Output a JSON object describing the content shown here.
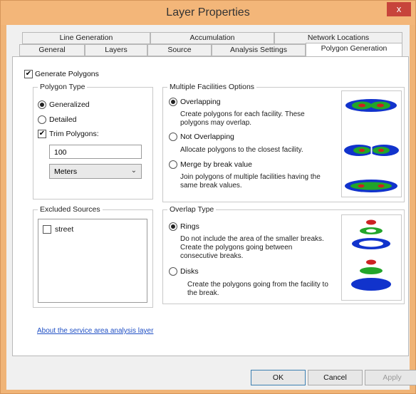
{
  "window": {
    "title": "Layer Properties",
    "close_glyph": "x"
  },
  "tabs_row1": [
    "Line Generation",
    "Accumulation",
    "Network Locations"
  ],
  "tabs_row2": [
    "General",
    "Layers",
    "Source",
    "Analysis Settings",
    "Polygon Generation"
  ],
  "generate_polygons": {
    "label": "Generate Polygons",
    "checked": true
  },
  "polygon_type": {
    "title": "Polygon Type",
    "generalized": "Generalized",
    "detailed": "Detailed",
    "trim_label": "Trim Polygons:",
    "trim_value": "100",
    "units": "Meters"
  },
  "multiple_facilities": {
    "title": "Multiple Facilities Options",
    "overlapping": "Overlapping",
    "overlapping_desc_1": "Create polygons for each facility. These",
    "overlapping_desc_2": "polygons may overlap.",
    "not_overlapping": "Not Overlapping",
    "not_overlapping_desc": "Allocate polygons to the closest facility.",
    "merge": "Merge by break value",
    "merge_desc_1": "Join polygons of multiple facilities having the",
    "merge_desc_2": "same break values."
  },
  "excluded_sources": {
    "title": "Excluded Sources",
    "items": [
      "street"
    ]
  },
  "overlap_type": {
    "title": "Overlap Type",
    "rings": "Rings",
    "rings_desc_1": "Do not include the area of the smaller breaks.",
    "rings_desc_2": "Create the polygons going between",
    "rings_desc_3": "consecutive breaks.",
    "disks": "Disks",
    "disks_desc_1": "Create the polygons going from the facility to",
    "disks_desc_2": "the break."
  },
  "about_link": "About the service area analysis layer",
  "buttons": {
    "ok": "OK",
    "cancel": "Cancel",
    "apply": "Apply"
  },
  "colors": {
    "titlebar": "#f3b679",
    "close": "#c7443b",
    "link": "#1f4fc4",
    "blue": "#1133cc",
    "green": "#22a52a",
    "red": "#cc2222"
  }
}
